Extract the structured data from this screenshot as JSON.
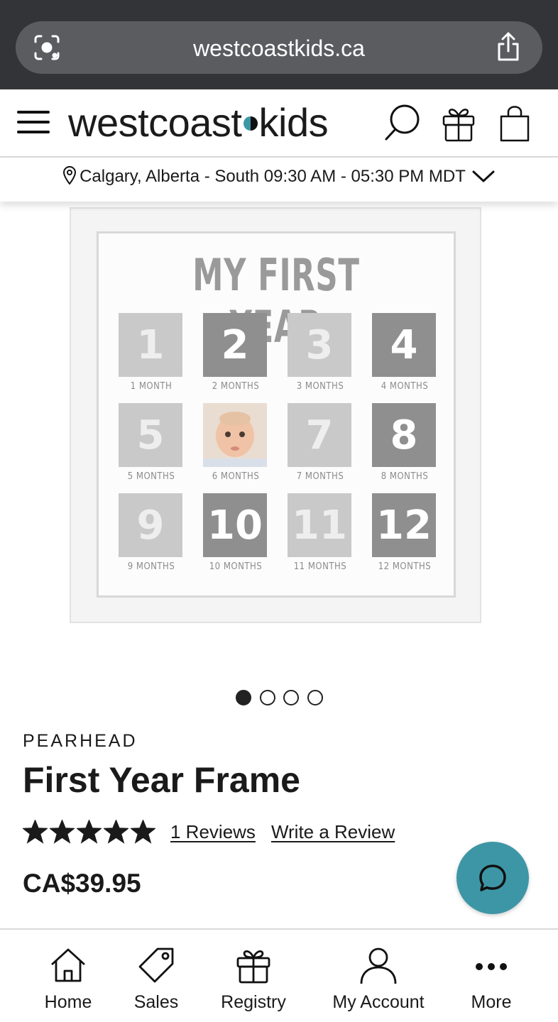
{
  "browser": {
    "url": "westcoastkids.ca",
    "lens_icon": "camera-lens-icon",
    "share_icon": "share-icon"
  },
  "header": {
    "logo_left": "westcoast",
    "logo_right": "kids",
    "menu_icon": "hamburger-menu-icon",
    "search_icon": "search-icon",
    "gift_icon": "gift-icon",
    "bag_icon": "shopping-bag-icon"
  },
  "store": {
    "location_text": "Calgary, Alberta - South 09:30 AM - 05:30 PM MDT"
  },
  "product_image": {
    "frame_title": "MY FIRST YEAR",
    "months": [
      {
        "number": "1",
        "caption": "1 MONTH",
        "style": "light"
      },
      {
        "number": "2",
        "caption": "2 MONTHS",
        "style": "dark"
      },
      {
        "number": "3",
        "caption": "3 MONTHS",
        "style": "light"
      },
      {
        "number": "4",
        "caption": "4 MONTHS",
        "style": "dark"
      },
      {
        "number": "5",
        "caption": "5 MONTHS",
        "style": "light"
      },
      {
        "number": "",
        "caption": "6 MONTHS",
        "style": "photo"
      },
      {
        "number": "7",
        "caption": "7 MONTHS",
        "style": "light"
      },
      {
        "number": "8",
        "caption": "8 MONTHS",
        "style": "dark"
      },
      {
        "number": "9",
        "caption": "9 MONTHS",
        "style": "light"
      },
      {
        "number": "10",
        "caption": "10 MONTHS",
        "style": "dark"
      },
      {
        "number": "11",
        "caption": "11 MONTHS",
        "style": "light"
      },
      {
        "number": "12",
        "caption": "12 MONTHS",
        "style": "dark"
      }
    ],
    "carousel_total": 4,
    "carousel_active": 1
  },
  "product": {
    "brand": "PEARHEAD",
    "title": "First Year Frame",
    "rating": 5,
    "rating_max": 5,
    "reviews_link": "1 Reviews",
    "write_review_link": "Write a Review",
    "price": "CA$39.95"
  },
  "chat": {
    "icon": "chat-bubble-icon",
    "color": "#3d96a5"
  },
  "bottom_nav": {
    "items": [
      {
        "label": "Home",
        "icon": "home-icon"
      },
      {
        "label": "Sales",
        "icon": "tag-icon"
      },
      {
        "label": "Registry",
        "icon": "gift-icon"
      },
      {
        "label": "My Account",
        "icon": "user-icon"
      },
      {
        "label": "More",
        "icon": "more-dots-icon"
      }
    ]
  },
  "colors": {
    "browser_bar": "#333437",
    "url_pill": "#5b5c60",
    "accent": "#3d96a5",
    "text": "#1a1a1a"
  }
}
